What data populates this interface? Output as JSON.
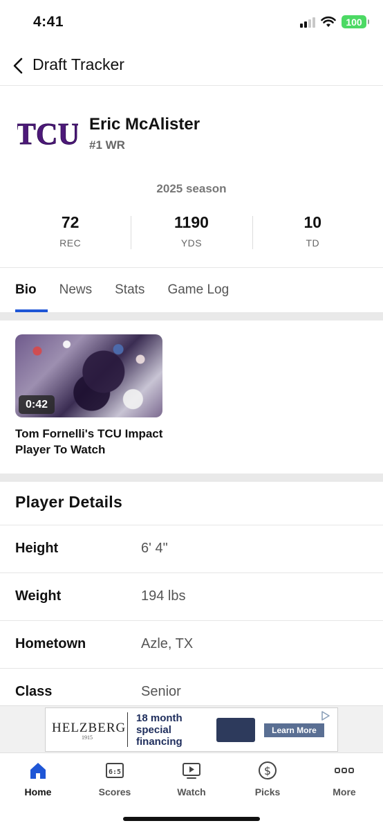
{
  "status_bar": {
    "time": "4:41",
    "battery": "100"
  },
  "nav": {
    "title": "Draft Tracker"
  },
  "player": {
    "team_logo_text": "TCU",
    "name": "Eric McAlister",
    "position": "#1 WR",
    "season": "2025 season",
    "stats": [
      {
        "value": "72",
        "label": "REC"
      },
      {
        "value": "1190",
        "label": "YDS"
      },
      {
        "value": "10",
        "label": "TD"
      }
    ]
  },
  "tabs": [
    {
      "label": "Bio",
      "active": true
    },
    {
      "label": "News",
      "active": false
    },
    {
      "label": "Stats",
      "active": false
    },
    {
      "label": "Game Log",
      "active": false
    }
  ],
  "video": {
    "duration": "0:42",
    "title": "Tom Fornelli's TCU Impact Player To Watch"
  },
  "player_details": {
    "title": "Player Details",
    "rows": [
      {
        "label": "Height",
        "value": "6' 4\""
      },
      {
        "label": "Weight",
        "value": "194 lbs"
      },
      {
        "label": "Hometown",
        "value": "Azle, TX"
      },
      {
        "label": "Class",
        "value": "Senior"
      }
    ]
  },
  "ad": {
    "brand": "HELZBERG",
    "brand_year": "1915",
    "line1": "18 month",
    "line2": "special",
    "line3": "financing",
    "button": "Learn More"
  },
  "bottom_nav": [
    {
      "label": "Home",
      "icon": "home-icon",
      "active": true
    },
    {
      "label": "Scores",
      "icon": "scores-icon",
      "active": false
    },
    {
      "label": "Watch",
      "icon": "watch-icon",
      "active": false
    },
    {
      "label": "Picks",
      "icon": "picks-icon",
      "active": false
    },
    {
      "label": "More",
      "icon": "more-icon",
      "active": false
    }
  ],
  "colors": {
    "accent": "#1f56d6",
    "tcu_purple": "#4d1979"
  }
}
